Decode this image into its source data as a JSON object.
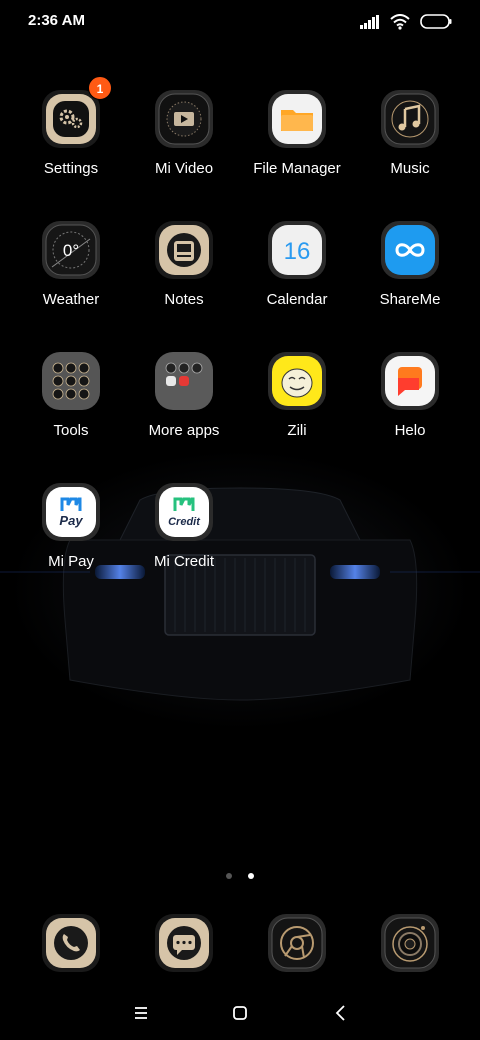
{
  "status_bar": {
    "time": "2:36 AM",
    "icons": [
      "signal-icon",
      "wifi-icon",
      "battery-icon"
    ]
  },
  "apps": [
    {
      "label": "Settings",
      "icon": "settings-gears-icon",
      "badge": "1"
    },
    {
      "label": "Mi Video",
      "icon": "video-play-icon"
    },
    {
      "label": "File Manager",
      "icon": "folder-icon"
    },
    {
      "label": "Music",
      "icon": "music-note-icon"
    },
    {
      "label": "Weather",
      "icon": "weather-gauge-icon",
      "icon_text": "0°"
    },
    {
      "label": "Notes",
      "icon": "notes-icon"
    },
    {
      "label": "Calendar",
      "icon": "calendar-icon",
      "icon_text": "16"
    },
    {
      "label": "ShareMe",
      "icon": "shareme-infinity-icon"
    },
    {
      "label": "Tools",
      "icon": "tools-folder-icon"
    },
    {
      "label": "More apps",
      "icon": "more-apps-folder-icon"
    },
    {
      "label": "Zili",
      "icon": "zili-face-icon"
    },
    {
      "label": "Helo",
      "icon": "helo-chat-icon"
    },
    {
      "label": "Mi Pay",
      "icon": "mi-pay-icon",
      "icon_text": "Pay"
    },
    {
      "label": "Mi Credit",
      "icon": "mi-credit-icon",
      "icon_text": "Credit"
    }
  ],
  "page_indicator": {
    "pages": 2,
    "current": 2
  },
  "dock": [
    {
      "icon": "phone-icon"
    },
    {
      "icon": "messages-icon"
    },
    {
      "icon": "chrome-browser-icon"
    },
    {
      "icon": "camera-lens-icon"
    }
  ],
  "nav_bar": [
    "menu-icon",
    "home-icon",
    "back-icon"
  ],
  "colors": {
    "background": "#000000",
    "badge": "#ff5a14",
    "folder_yellow": "#ffa726",
    "shareme_blue": "#1e9bf0",
    "mi_green": "#26c17e",
    "helo_orange": "#ff5a28"
  }
}
